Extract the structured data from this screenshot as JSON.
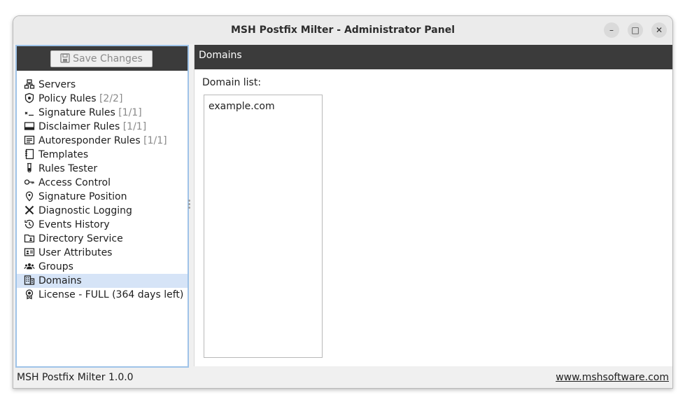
{
  "window": {
    "title": "MSH Postfix Milter - Administrator Panel",
    "controls": {
      "minimize": "–",
      "maximize": "□",
      "close": "✕"
    }
  },
  "toolbar": {
    "save_label": "Save Changes"
  },
  "sidebar": {
    "items": [
      {
        "label": "Servers",
        "count": "",
        "icon": "servers-icon"
      },
      {
        "label": "Policy Rules",
        "count": "[2/2]",
        "icon": "shield-icon"
      },
      {
        "label": "Signature Rules",
        "count": "[1/1]",
        "icon": "signature-icon"
      },
      {
        "label": "Disclaimer Rules",
        "count": "[1/1]",
        "icon": "disclaimer-icon"
      },
      {
        "label": "Autoresponder Rules",
        "count": "[1/1]",
        "icon": "autoresponder-icon"
      },
      {
        "label": "Templates",
        "count": "",
        "icon": "templates-icon"
      },
      {
        "label": "Rules Tester",
        "count": "",
        "icon": "test-tube-icon"
      },
      {
        "label": "Access Control",
        "count": "",
        "icon": "key-icon"
      },
      {
        "label": "Signature Position",
        "count": "",
        "icon": "location-pin-icon"
      },
      {
        "label": "Diagnostic Logging",
        "count": "",
        "icon": "tools-icon"
      },
      {
        "label": "Events History",
        "count": "",
        "icon": "history-icon"
      },
      {
        "label": "Directory Service",
        "count": "",
        "icon": "folder-user-icon"
      },
      {
        "label": "User Attributes",
        "count": "",
        "icon": "id-card-icon"
      },
      {
        "label": "Groups",
        "count": "",
        "icon": "groups-icon"
      },
      {
        "label": "Domains",
        "count": "",
        "icon": "building-icon",
        "selected": true
      },
      {
        "label": "License - FULL (364 days left)",
        "count": "",
        "icon": "award-icon"
      }
    ]
  },
  "main": {
    "header": "Domains",
    "list_label": "Domain list:",
    "domains": [
      "example.com"
    ]
  },
  "status": {
    "version": "MSH Postfix Milter 1.0.0",
    "website": "www.mshsoftware.com"
  },
  "colors": {
    "header_bg": "#3b3b3b",
    "selection_bg": "#d6e4f7",
    "panel_border": "#9fc3e8"
  }
}
